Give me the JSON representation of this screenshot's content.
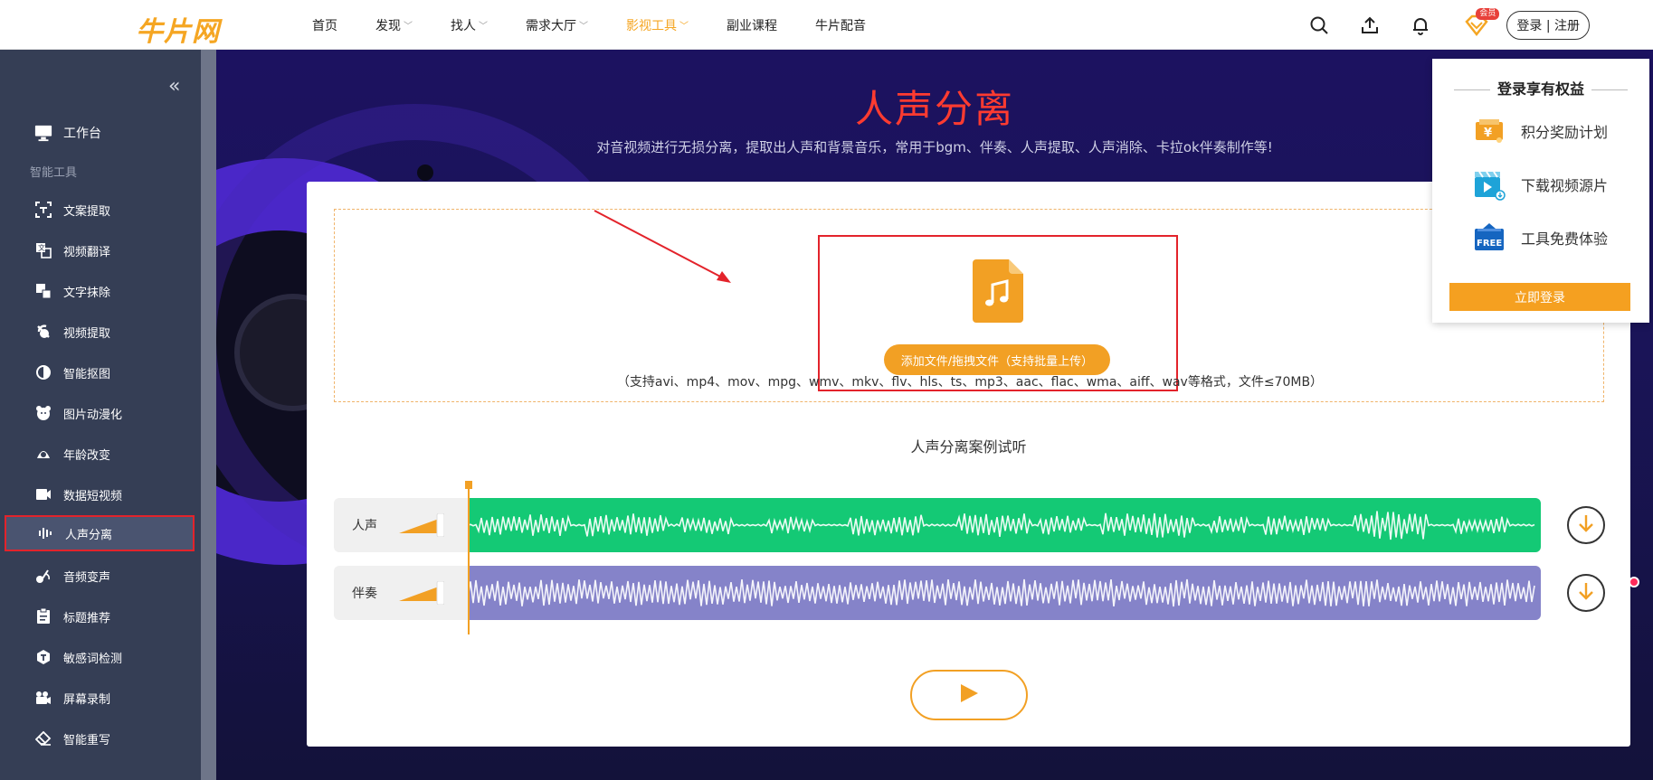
{
  "brand": {
    "logo_text": "牛片网",
    "accent": "#f5a623"
  },
  "nav": {
    "items": [
      {
        "label": "首页",
        "has_menu": false,
        "active": false
      },
      {
        "label": "发现",
        "has_menu": true,
        "active": false
      },
      {
        "label": "找人",
        "has_menu": true,
        "active": false
      },
      {
        "label": "需求大厅",
        "has_menu": true,
        "active": false
      },
      {
        "label": "影视工具",
        "has_menu": true,
        "active": true
      },
      {
        "label": "副业课程",
        "has_menu": false,
        "active": false
      },
      {
        "label": "牛片配音",
        "has_menu": false,
        "active": false
      }
    ],
    "vip_badge": "会员",
    "login_label": "登录 | 注册"
  },
  "sidebar": {
    "workbench": "工作台",
    "section_label": "智能工具",
    "items": [
      {
        "label": "文案提取",
        "icon": "text-extract-icon"
      },
      {
        "label": "视频翻译",
        "icon": "translate-icon"
      },
      {
        "label": "文字抹除",
        "icon": "text-erase-icon"
      },
      {
        "label": "视频提取",
        "icon": "video-extract-icon"
      },
      {
        "label": "智能抠图",
        "icon": "cutout-icon"
      },
      {
        "label": "图片动漫化",
        "icon": "anime-icon"
      },
      {
        "label": "年龄改变",
        "icon": "age-icon"
      },
      {
        "label": "数据短视频",
        "icon": "camera-icon"
      },
      {
        "label": "人声分离",
        "icon": "waveform-icon",
        "selected": true
      },
      {
        "label": "音频变声",
        "icon": "voice-change-icon"
      },
      {
        "label": "标题推荐",
        "icon": "title-icon"
      },
      {
        "label": "敏感词检测",
        "icon": "sensitive-icon"
      },
      {
        "label": "屏幕录制",
        "icon": "record-icon"
      },
      {
        "label": "智能重写",
        "icon": "eraser-icon"
      }
    ]
  },
  "hero": {
    "title": "人声分离",
    "subtitle": "对音视频进行无损分离，提取出人声和背景音乐，常用于bgm、伴奏、人声提取、人声消除、卡拉ok伴奏制作等!"
  },
  "upload": {
    "button_label": "添加文件/拖拽文件（支持批量上传）",
    "formats": "（支持avi、mp4、mov、mpg、wmv、mkv、flv、hls、ts、mp3、aac、flac、wma、aiff、wav等格式，文件≤70MB）"
  },
  "demo": {
    "title": "人声分离案例试听",
    "tracks": [
      {
        "label": "人声",
        "color": "#14c975"
      },
      {
        "label": "伴奏",
        "color": "#8583c9"
      }
    ]
  },
  "login_panel": {
    "title": "登录享有权益",
    "perks": [
      {
        "label": "积分奖励计划",
        "icon": "points-reward-icon"
      },
      {
        "label": "下载视频源片",
        "icon": "video-download-icon"
      },
      {
        "label": "工具免费体验",
        "icon": "free-tag-icon",
        "icon_text": "FREE"
      }
    ],
    "button_label": "立即登录"
  }
}
